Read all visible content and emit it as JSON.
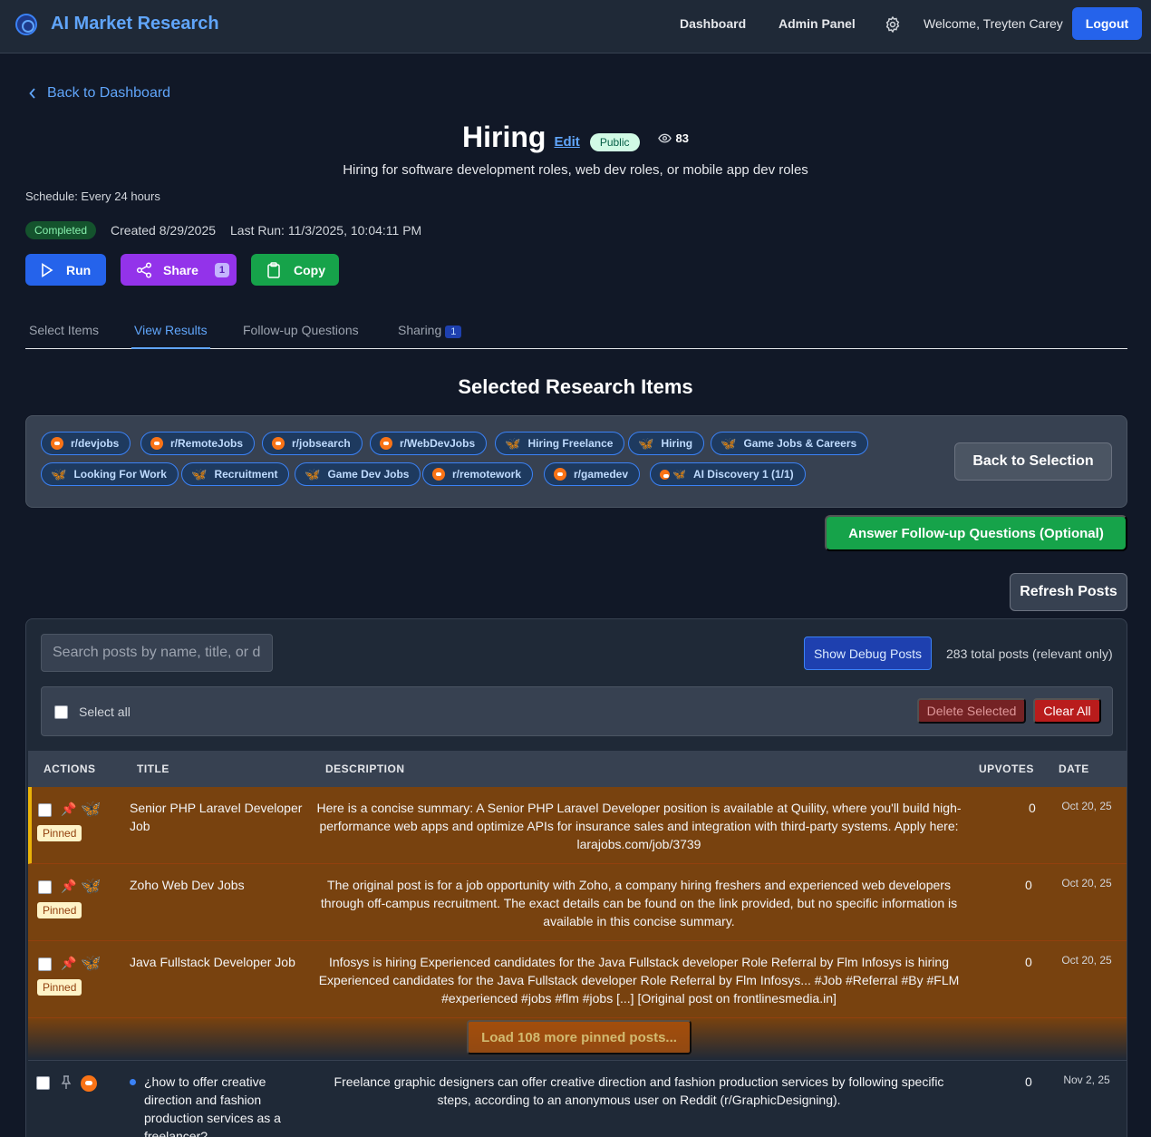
{
  "nav": {
    "brand": "AI Market Research",
    "links": [
      "Dashboard",
      "Admin Panel"
    ],
    "welcome": "Welcome, Treyten Carey",
    "logout": "Logout"
  },
  "back_link": "Back to Dashboard",
  "research": {
    "title": "Hiring",
    "edit": "Edit",
    "visibility": "Public",
    "views": "83",
    "description": "Hiring for software development roles, web dev roles, or mobile app dev roles",
    "schedule": "Schedule: Every 24 hours",
    "status": "Completed",
    "created": "Created 8/29/2025",
    "last_run": "Last Run: 11/3/2025, 10:04:11 PM"
  },
  "actions": {
    "run": "Run",
    "share": "Share",
    "share_count": "1",
    "copy": "Copy"
  },
  "tabs": [
    {
      "label": "Select Items",
      "active": false
    },
    {
      "label": "View Results",
      "active": true
    },
    {
      "label": "Follow-up Questions",
      "active": false
    },
    {
      "label": "Sharing",
      "count": "1",
      "active": false
    }
  ],
  "selected_items": {
    "title": "Selected Research Items",
    "chips": [
      {
        "label": "r/devjobs",
        "source": "reddit"
      },
      {
        "label": "r/RemoteJobs",
        "source": "reddit"
      },
      {
        "label": "r/jobsearch",
        "source": "reddit"
      },
      {
        "label": "r/WebDevJobs",
        "source": "reddit"
      },
      {
        "label": "Hiring Freelance",
        "source": "bluesky"
      },
      {
        "label": "Hiring",
        "source": "bluesky"
      },
      {
        "label": "Game Jobs & Careers",
        "source": "bluesky"
      },
      {
        "label": "Looking For Work",
        "source": "bluesky"
      },
      {
        "label": "Recruitment",
        "source": "bluesky"
      },
      {
        "label": "Game Dev Jobs",
        "source": "bluesky"
      },
      {
        "label": "r/remotework",
        "source": "reddit"
      },
      {
        "label": "r/gamedev",
        "source": "reddit"
      },
      {
        "label": "AI Discovery 1 (1/1)",
        "source": "both"
      }
    ],
    "back_to_selection": "Back to Selection"
  },
  "answer_followup": "Answer Follow-up Questions (Optional)",
  "refresh_posts": "Refresh Posts",
  "posts": {
    "search_placeholder": "Search posts by name, title, or description...",
    "show_debug": "Show Debug Posts",
    "total": "283 total posts (relevant only)",
    "select_all": "Select all",
    "delete_selected": "Delete Selected",
    "clear_all": "Clear All",
    "columns": [
      "ACTIONS",
      "TITLE",
      "DESCRIPTION",
      "UPVOTES",
      "DATE"
    ],
    "pinned_label": "Pinned",
    "rows": [
      {
        "title": "Senior PHP Laravel Developer Job",
        "description": "Here is a concise summary: A Senior PHP Laravel Developer position is available at Quility, where you'll build high-performance web apps and optimize APIs for insurance sales and integration with third-party systems. Apply here: larajobs.com/job/3739",
        "upvotes": "0",
        "date": "Oct 20, 25"
      },
      {
        "title": "Zoho Web Dev Jobs",
        "description": "The original post is for a job opportunity with Zoho, a company hiring freshers and experienced web developers through off-campus recruitment. The exact details can be found on the link provided, but no specific information is available in this concise summary.",
        "upvotes": "0",
        "date": "Oct 20, 25"
      },
      {
        "title": "Java Fullstack Developer Job",
        "description": "Infosys is hiring Experienced candidates for the Java Fullstack developer Role Referral by Flm Infosys is hiring Experienced candidates for the Java Fullstack developer Role Referral by Flm Infosys... #Job #Referral #By #FLM #experienced #jobs #flm #jobs [...] [Original post on frontlinesmedia.in]",
        "upvotes": "0",
        "date": "Oct 20, 25"
      }
    ],
    "load_more": "Load 108 more pinned posts...",
    "unpinned_rows": [
      {
        "title": "¿how to offer creative direction and fashion production services as a freelancer?",
        "description": "Freelance graphic designers can offer creative direction and fashion production services by following specific steps, according to an anonymous user on Reddit (r/GraphicDesigning).",
        "upvotes": "0",
        "date": "Nov 2, 25"
      }
    ]
  }
}
